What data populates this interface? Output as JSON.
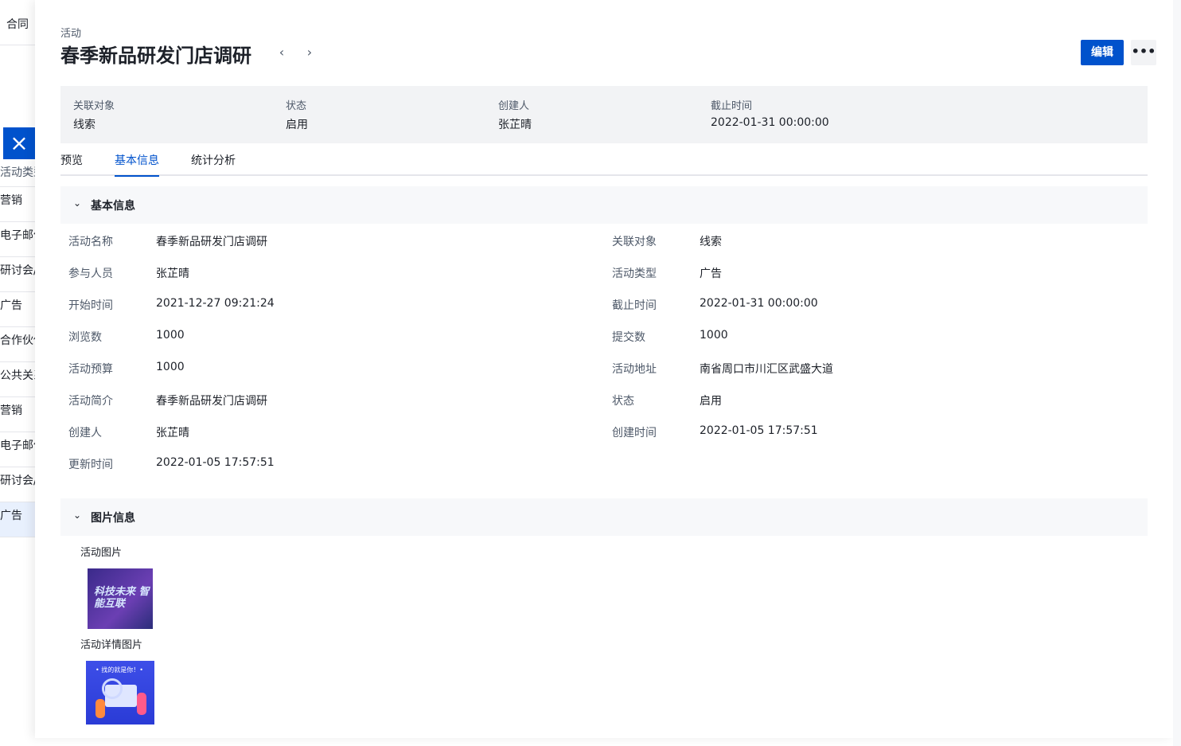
{
  "background": {
    "tab_label": "合同",
    "close_icon": "×",
    "list_items": [
      "活动类型",
      "营销",
      "电子邮件",
      "研讨会/",
      "广告",
      "合作伙伴",
      "公共关系",
      "营销",
      "电子邮件",
      "研讨会/",
      "广告"
    ]
  },
  "header": {
    "breadcrumb": "活动",
    "title": "春季新品研发门店调研",
    "prev_icon": "‹",
    "next_icon": "›",
    "edit_label": "编辑",
    "more_icon": "•••"
  },
  "summary": [
    {
      "label": "关联对象",
      "value": "线索"
    },
    {
      "label": "状态",
      "value": "启用"
    },
    {
      "label": "创建人",
      "value": "张芷晴"
    },
    {
      "label": "截止时间",
      "value": "2022-01-31 00:00:00"
    }
  ],
  "tabs": [
    "预览",
    "基本信息",
    "统计分析"
  ],
  "basic_section": {
    "title": "基本信息",
    "left": [
      {
        "label": "活动名称",
        "value": "春季新品研发门店调研"
      },
      {
        "label": "参与人员",
        "value": "张芷晴"
      },
      {
        "label": "开始时间",
        "value": "2021-12-27 09:21:24"
      },
      {
        "label": "浏览数",
        "value": "1000"
      },
      {
        "label": "活动预算",
        "value": "1000"
      },
      {
        "label": "活动简介",
        "value": "春季新品研发门店调研"
      },
      {
        "label": "创建人",
        "value": "张芷晴"
      },
      {
        "label": "更新时间",
        "value": "2022-01-05 17:57:51"
      }
    ],
    "right": [
      {
        "label": "关联对象",
        "value": "线索"
      },
      {
        "label": "活动类型",
        "value": "广告"
      },
      {
        "label": "截止时间",
        "value": "2022-01-31 00:00:00"
      },
      {
        "label": "提交数",
        "value": "1000"
      },
      {
        "label": "活动地址",
        "value": "南省周口市川汇区武盛大道"
      },
      {
        "label": "状态",
        "value": "启用"
      },
      {
        "label": "创建时间",
        "value": "2022-01-05 17:57:51"
      }
    ]
  },
  "image_section": {
    "title": "图片信息",
    "activity_image_label": "活动图片",
    "activity_image_text": "科技未来 智能互联",
    "detail_image_label": "活动详情图片",
    "detail_image_text": "• 找的就是你！•"
  },
  "colors": {
    "primary": "#0052cc",
    "panel": "#f2f3f5"
  }
}
